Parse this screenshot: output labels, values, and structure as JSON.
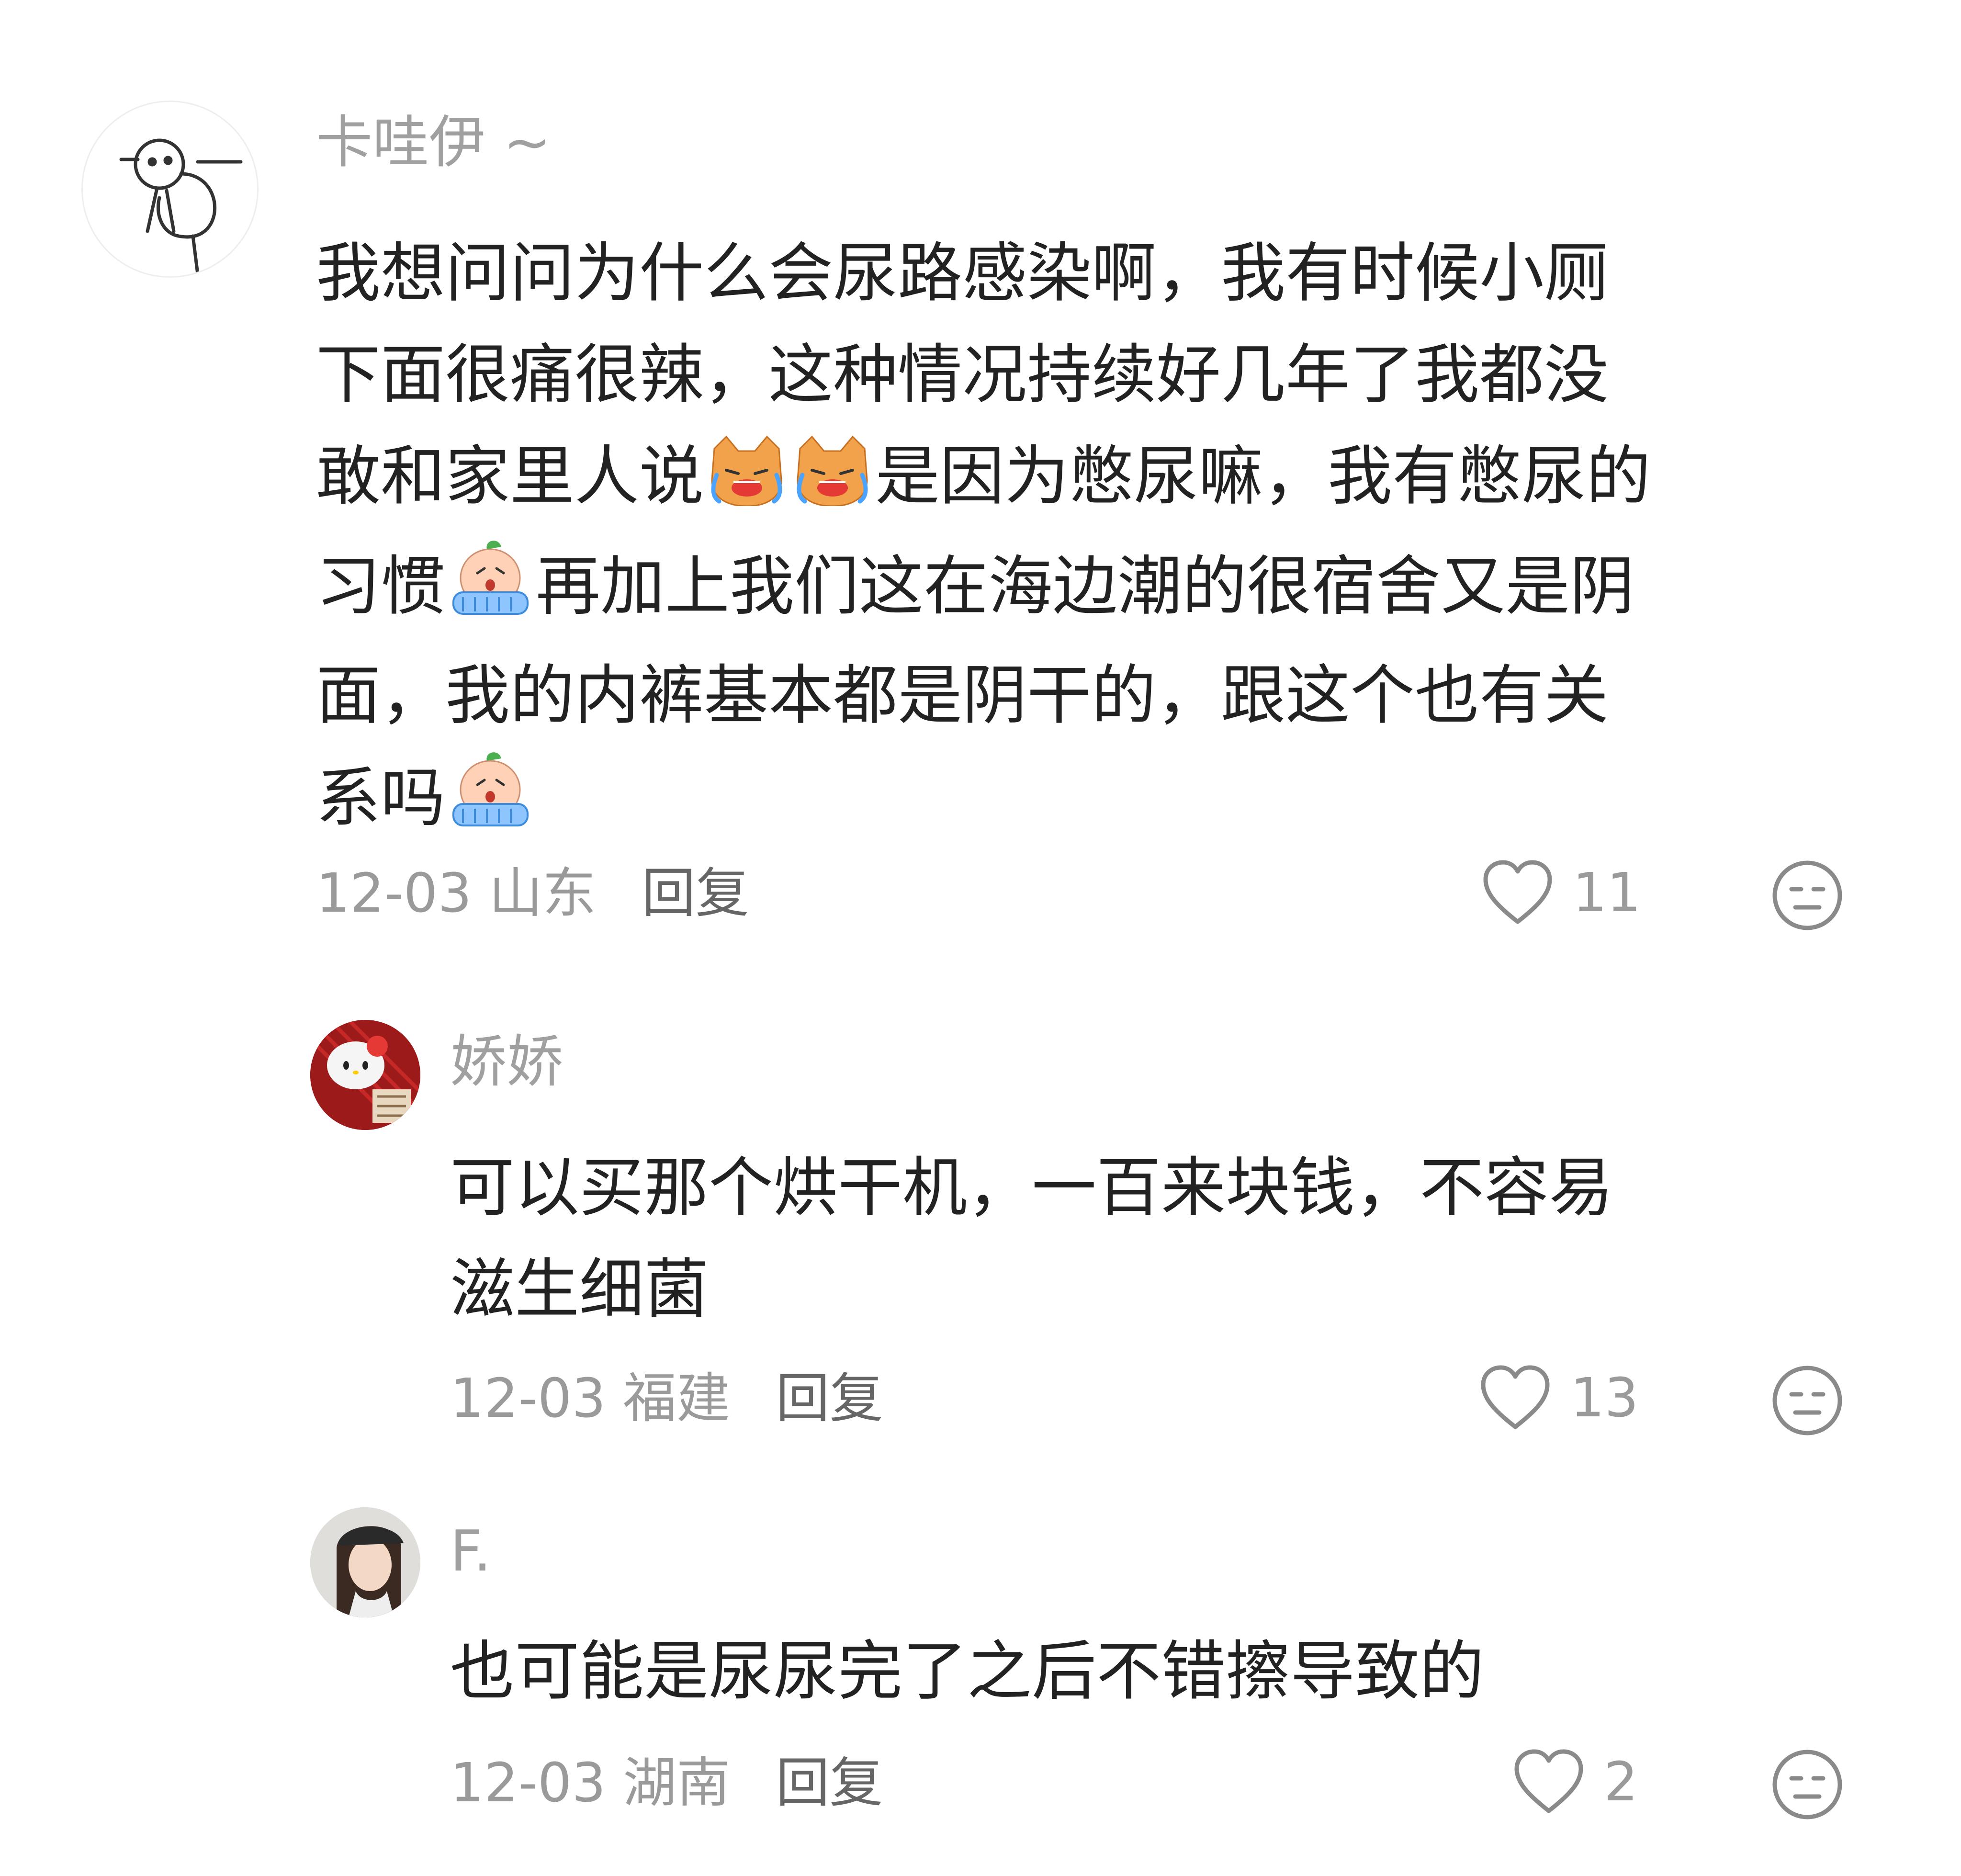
{
  "comments": [
    {
      "username": "卡哇伊 ~",
      "content_lines": [
        "我想问问为什么会尿路感染啊，我有时候小厕",
        "下面很痛很辣，这种情况持续好几年了我都没",
        "敢和家里人说",
        "是因为憋尿嘛，我有憋尿的",
        "习惯",
        "再加上我们这在海边潮的很宿舍又是阴",
        "面，我的内裤基本都是阴干的，跟这个也有关",
        "系吗"
      ],
      "date": "12-03",
      "location": "山东",
      "reply_label": "回复",
      "likes": "11",
      "emojis": [
        "crying-cat-emoji",
        "crying-baby-emoji"
      ]
    },
    {
      "username": "娇娇",
      "content_lines": [
        "可以买那个烘干机，一百来块钱，不容易",
        "滋生细菌"
      ],
      "date": "12-03",
      "location": "福建",
      "reply_label": "回复",
      "likes": "13"
    },
    {
      "username": "F.",
      "content_lines": [
        "也可能是尿尿完了之后不错擦导致的"
      ],
      "date": "12-03",
      "location": "湖南",
      "reply_label": "回复",
      "likes": "2"
    }
  ],
  "colors": {
    "text": "#222222",
    "username": "#a0a0a0",
    "meta": "#9a9a9a",
    "reply": "#666666",
    "icon": "#8a8a8a"
  }
}
